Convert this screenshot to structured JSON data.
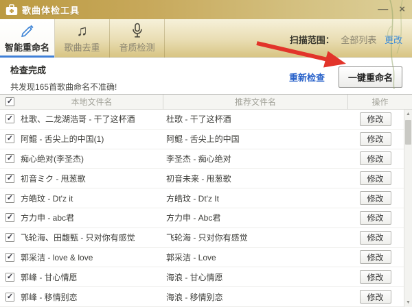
{
  "window": {
    "title": "歌曲体检工具"
  },
  "icons": {
    "check": "✓",
    "minimize": "—",
    "close": "×",
    "music_note": "♫",
    "scroll_up": "▲",
    "scroll_down": "▼"
  },
  "tabs": [
    {
      "label": "智能重命名",
      "icon": "pencil-icon",
      "active": true
    },
    {
      "label": "歌曲去重",
      "icon": "music-note-icon",
      "active": false
    },
    {
      "label": "音质检测",
      "icon": "microphone-icon",
      "active": false
    }
  ],
  "scan_scope": {
    "label": "扫描范围：",
    "value": "全部列表",
    "change_link": "更改"
  },
  "status": {
    "title": "检查完成",
    "detail": "共发现165首歌曲命名不准确!",
    "recheck_link": "重新检查",
    "rename_all_button": "一键重命名"
  },
  "table": {
    "columns": [
      "本地文件名",
      "推荐文件名",
      "操作"
    ],
    "action_label": "修改",
    "rows": [
      {
        "local": "杜歌、二龙湖浩哥 - 干了这杯酒",
        "suggested": "杜歌 - 干了这杯酒"
      },
      {
        "local": "阿鲲 - 舌尖上的中国(1)",
        "suggested": "阿鲲 - 舌尖上的中国"
      },
      {
        "local": "痴心绝对(李圣杰)",
        "suggested": "李圣杰 - 痴心绝对"
      },
      {
        "local": "初音ミク - 甩葱歌",
        "suggested": "初音未来 - 甩葱歌"
      },
      {
        "local": "方皓玟 - Dt'z it",
        "suggested": "方皓玟 - Dt'z It"
      },
      {
        "local": "方力申 - abc君",
        "suggested": "方力申 - Abc君"
      },
      {
        "local": "飞轮海、田馥甄 - 只对你有感觉",
        "suggested": "飞轮海 - 只对你有感觉"
      },
      {
        "local": "郭采洁 - love & love",
        "suggested": "郭采洁 - Love"
      },
      {
        "local": "郭峰 - 甘心情愿",
        "suggested": "海浪 - 甘心情愿"
      },
      {
        "local": "郭峰 - 移情别恋",
        "suggested": "海浪 - 移情别恋"
      }
    ]
  },
  "colors": {
    "titlebar_gold": "#c7a85a",
    "tab_active_underline": "#3f7fd6",
    "link_blue": "#2a63ca",
    "annotation_arrow_red": "#e2342a"
  }
}
